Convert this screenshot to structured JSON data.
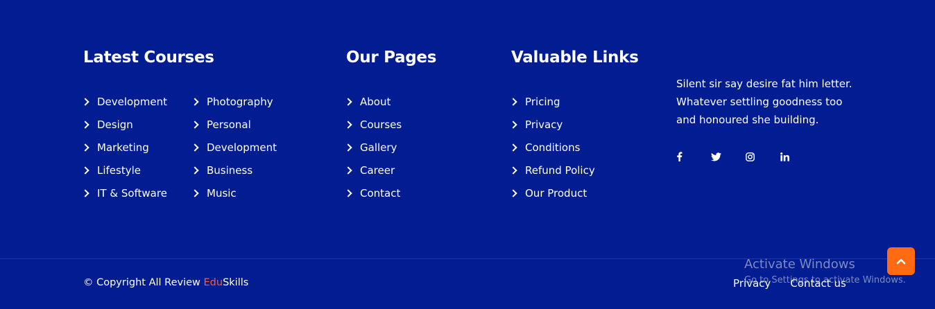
{
  "courses": {
    "heading": "Latest Courses",
    "col1": [
      "Development",
      "Design",
      "Marketing",
      "Lifestyle",
      "IT & Software"
    ],
    "col2": [
      "Photography",
      "Personal",
      "Development",
      "Business",
      "Music"
    ]
  },
  "pages": {
    "heading": "Our Pages",
    "items": [
      "About",
      "Courses",
      "Gallery",
      "Career",
      "Contact"
    ]
  },
  "links": {
    "heading": "Valuable Links",
    "items": [
      "Pricing",
      "Privacy",
      "Conditions",
      "Refund Policy",
      "Our Product"
    ]
  },
  "about": {
    "text": "Silent sir say desire fat him letter. Whatever settling goodness too and honoured she building.",
    "social": [
      "facebook-icon",
      "twitter-icon",
      "instagram-icon",
      "linkedin-icon"
    ]
  },
  "bottom": {
    "copyright_prefix": "© Copyright All Review ",
    "brand_accent": "Edu",
    "brand_rest": "Skills",
    "links": [
      "Privacy",
      "Contact us"
    ]
  },
  "watermark": {
    "title": "Activate Windows",
    "subtitle": "Go to Settings to activate Windows."
  },
  "colors": {
    "background": "#021d92",
    "accent": "#ff5a2c",
    "scroll_button": "#ff6a13"
  }
}
